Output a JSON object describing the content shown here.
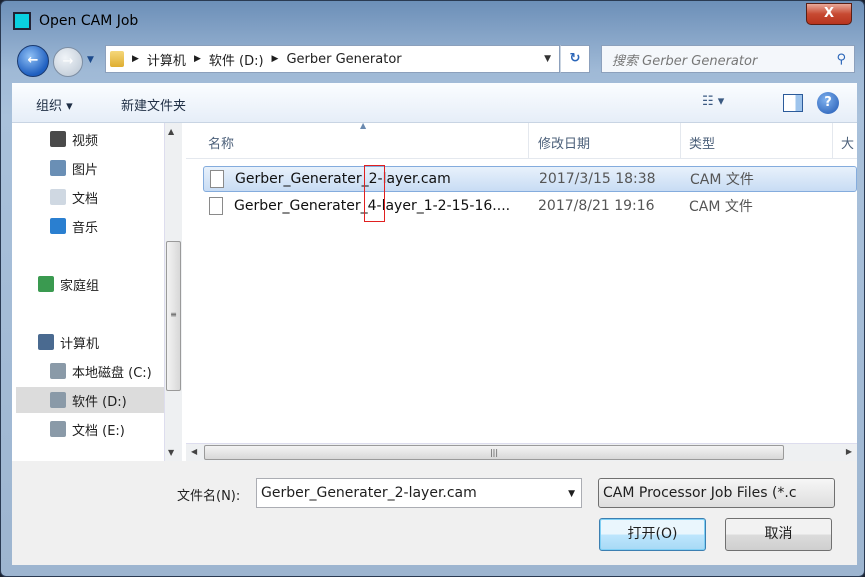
{
  "window": {
    "title": "Open CAM Job",
    "close_label": "X"
  },
  "nav": {
    "breadcrumbs": [
      "计算机",
      "软件 (D:)",
      "Gerber Generator"
    ],
    "search_placeholder": "搜索 Gerber Generator"
  },
  "toolbar": {
    "organize": "组织 ▾",
    "new_folder": "新建文件夹",
    "help": "?"
  },
  "sidebar": {
    "items": [
      {
        "label": "视频",
        "icon": "video-icon",
        "color": "#4a4a4a"
      },
      {
        "label": "图片",
        "icon": "pictures-icon",
        "color": "#6a8fb5"
      },
      {
        "label": "文档",
        "icon": "documents-icon",
        "color": "#cfd8e2"
      },
      {
        "label": "音乐",
        "icon": "music-icon",
        "color": "#2a7fd0"
      },
      {
        "label": "家庭组",
        "icon": "homegroup-icon",
        "color": "#3a9a50"
      },
      {
        "label": "计算机",
        "icon": "computer-icon",
        "color": "#4a6a90"
      },
      {
        "label": "本地磁盘 (C:)",
        "icon": "drive-icon",
        "color": "#8a9aa8"
      },
      {
        "label": "软件 (D:)",
        "icon": "drive-icon",
        "color": "#8a9aa8",
        "selected": true
      },
      {
        "label": "文档 (E:)",
        "icon": "drive-icon",
        "color": "#8a9aa8"
      }
    ]
  },
  "columns": [
    "名称",
    "修改日期",
    "类型",
    "大"
  ],
  "files": [
    {
      "name": "Gerber_Generater_2-layer.cam",
      "date": "2017/3/15 18:38",
      "type": "CAM 文件",
      "selected": true
    },
    {
      "name": "Gerber_Generater_4-layer_1-2-15-16....",
      "date": "2017/8/21 19:16",
      "type": "CAM 文件"
    }
  ],
  "footer": {
    "filename_label": "文件名(N):",
    "filename_value": "Gerber_Generater_2-layer.cam",
    "filter_value": "CAM Processor Job Files (*.c",
    "open": "打开(O)",
    "cancel": "取消"
  }
}
